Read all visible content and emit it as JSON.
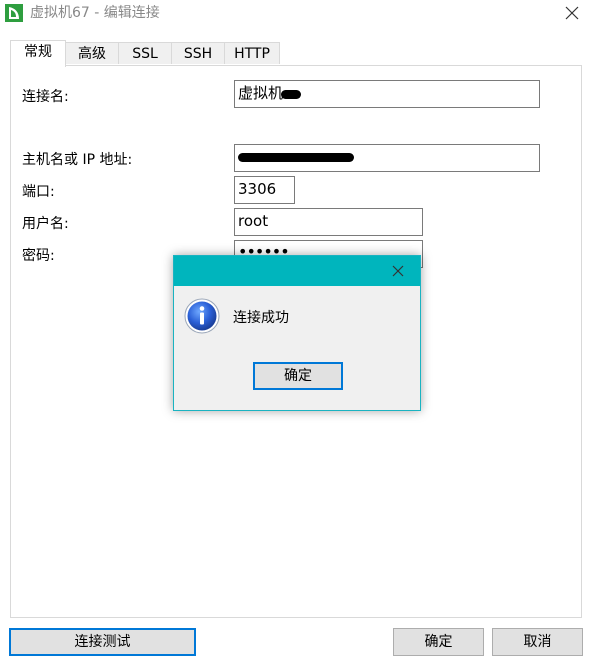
{
  "window": {
    "title": "虚拟机67 - 编辑连接",
    "icon": "navicat-logo-icon",
    "close_icon": "close-icon"
  },
  "tabs": [
    {
      "label": "常规",
      "active": true
    },
    {
      "label": "高级",
      "active": false
    },
    {
      "label": "SSL",
      "active": false
    },
    {
      "label": "SSH",
      "active": false
    },
    {
      "label": "HTTP",
      "active": false
    }
  ],
  "form": {
    "connection_name_label": "连接名:",
    "connection_name_value": "虚拟机",
    "host_label": "主机名或 IP 地址:",
    "host_value": "",
    "port_label": "端口:",
    "port_value": "3306",
    "user_label": "用户名:",
    "user_value": "root",
    "password_label": "密码:",
    "password_value": "••••••"
  },
  "footer": {
    "test_button": "连接测试",
    "ok_button": "确定",
    "cancel_button": "取消"
  },
  "dialog": {
    "message": "连接成功",
    "ok_button": "确定",
    "icon": "info-icon",
    "title_color": "#00b5bd"
  }
}
